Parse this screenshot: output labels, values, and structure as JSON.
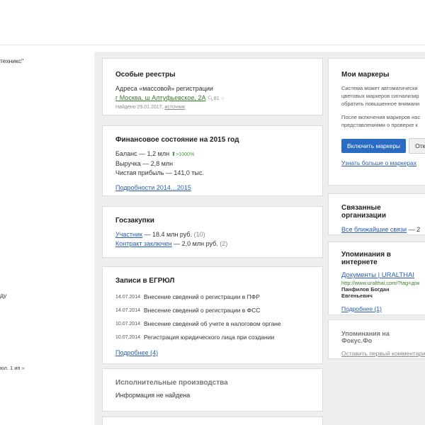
{
  "left": {
    "company_fragment": "техникс\"",
    "middle_fragment": "ду",
    "bottom_fragment_text": "юл. 1 ип",
    "bottom_fragment_link": "»"
  },
  "special": {
    "title": "Особые реестры",
    "desc": "Адреса «массовой» регистрации",
    "address_link": "г Москва, ш Алтуфьевское, 2А",
    "count": "81",
    "found_prefix": "Найдено 29.01.2017,",
    "source_link": "источник"
  },
  "finance": {
    "title": "Финансовое состояние на 2015 год",
    "balance": "Баланс — 1,2 млн",
    "growth": ">1000%",
    "revenue": "Выручка — 2,8 млн",
    "profit": "Чистая прибыль — 141,0 тыс.",
    "details_link": "Подробности 2014…2015"
  },
  "goszakupki": {
    "title": "Госзакупки",
    "participant_link": "Участник",
    "participant_value": "— 18.4 млн руб.",
    "participant_count": "(10)",
    "contract_link": "Контракт заключен",
    "contract_value": "— 2,0 млн руб.",
    "contract_count": "(2)"
  },
  "egrul": {
    "title": "Записи в ЕГРЮЛ",
    "rows": [
      {
        "date": "14.07.2014",
        "text": "Внесение сведений о регистрации в ПФР"
      },
      {
        "date": "14.07.2014",
        "text": "Внесение сведений о регистрации в ФСС"
      },
      {
        "date": "10.07.2014",
        "text": "Внесение сведений об учете в налоговом органе"
      },
      {
        "date": "10.07.2014",
        "text": "Регистрация юридического лица при создании"
      }
    ],
    "more_link": "Подробнее (4)"
  },
  "ip": {
    "title": "Исполнительные производства",
    "status": "Информация не найдена"
  },
  "markers": {
    "title": "Мои маркеры",
    "para1": [
      "Система может автоматически",
      "цветовых маркеров сигнализир",
      "обратить повышенное внимани"
    ],
    "para2": [
      "После включения маркеров нас",
      "представлениями о проверке к"
    ],
    "enable_button": "Включить маркеры",
    "cancel_button": "Отка",
    "learn_link": "Узнать больше о маркерах"
  },
  "related": {
    "title": "Связанные организации",
    "link": "Все ближайшие связи",
    "count": "— 2"
  },
  "mentions": {
    "title": "Упоминания в интернете",
    "doc_link": "Документы | URALTHAI",
    "url": "http://www.uralthai.com/?tag=док",
    "person": "Панфилов Богдан Евгеньевич",
    "more_link": "Подробнее (1)"
  },
  "focus": {
    "title": "Упоминания на Фокус.Фо",
    "link": "Оставить первый комментари"
  },
  "colors": {
    "accent": "#2a6cc4",
    "link": "#2a5db0",
    "green": "#3a7d2a",
    "background": "#eeeeee"
  }
}
